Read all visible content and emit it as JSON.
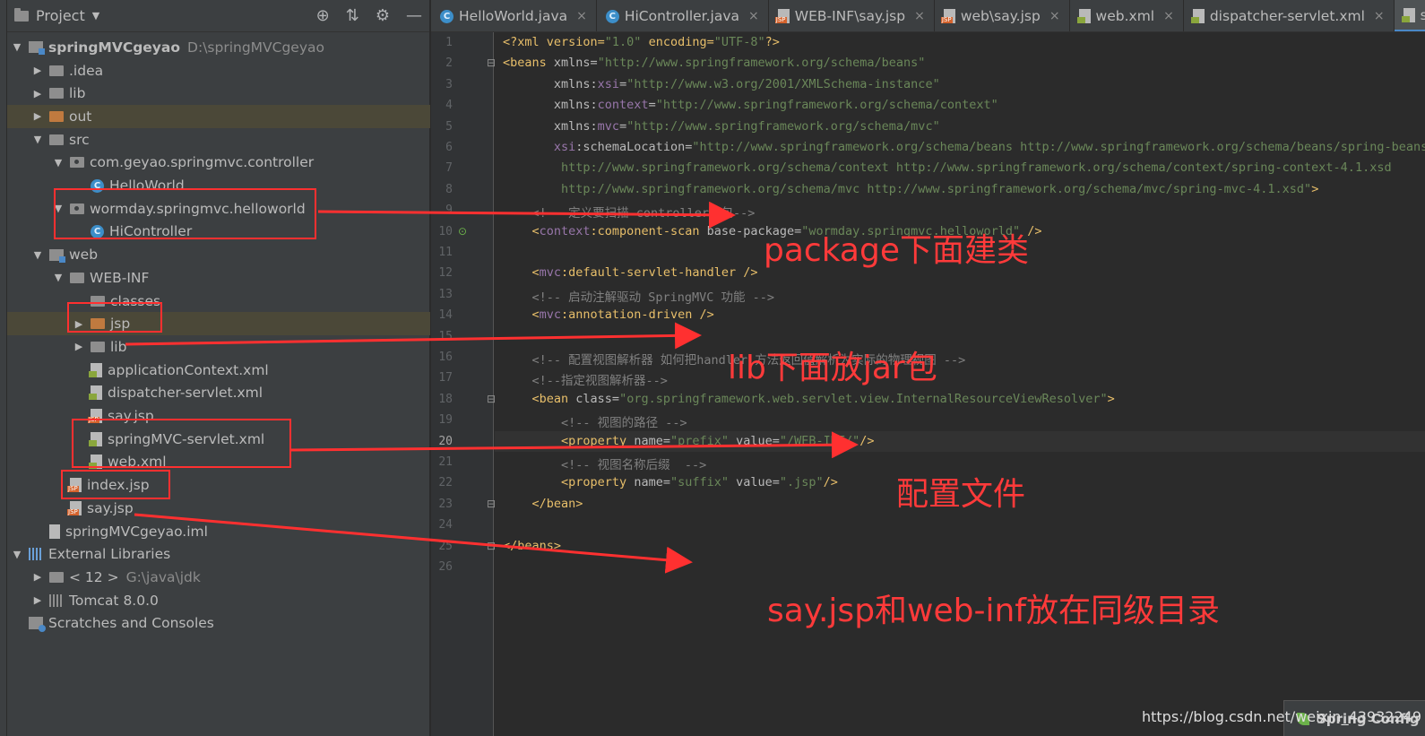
{
  "panel": {
    "title": "Project",
    "tools": {
      "locate": "⊕",
      "collapse": "⇅",
      "settings": "⚙",
      "hide": "—"
    }
  },
  "tree": [
    {
      "depth": 0,
      "arrow": "▼",
      "icon": "module",
      "label": "springMVCgeyao",
      "path": "D:\\springMVCgeyao",
      "bold": true
    },
    {
      "depth": 1,
      "arrow": "▶",
      "icon": "folder",
      "label": ".idea"
    },
    {
      "depth": 1,
      "arrow": "▶",
      "icon": "folder",
      "label": "lib"
    },
    {
      "depth": 1,
      "arrow": "▶",
      "icon": "folder-orange",
      "label": "out",
      "highlight": true
    },
    {
      "depth": 1,
      "arrow": "▼",
      "icon": "folder",
      "label": "src"
    },
    {
      "depth": 2,
      "arrow": "▼",
      "icon": "package",
      "label": "com.geyao.springmvc.controller"
    },
    {
      "depth": 3,
      "arrow": "",
      "icon": "class",
      "label": "HelloWorld"
    },
    {
      "depth": 2,
      "arrow": "▼",
      "icon": "package",
      "label": "wormday.springmvc.helloworld"
    },
    {
      "depth": 3,
      "arrow": "",
      "icon": "class",
      "label": "HiController"
    },
    {
      "depth": 1,
      "arrow": "▼",
      "icon": "module",
      "label": "web"
    },
    {
      "depth": 2,
      "arrow": "▼",
      "icon": "folder",
      "label": "WEB-INF"
    },
    {
      "depth": 3,
      "arrow": "",
      "icon": "folder",
      "label": "classes"
    },
    {
      "depth": 3,
      "arrow": "▶",
      "icon": "folder-orange",
      "label": "jsp",
      "highlight": true
    },
    {
      "depth": 3,
      "arrow": "▶",
      "icon": "folder",
      "label": "lib"
    },
    {
      "depth": 3,
      "arrow": "",
      "icon": "xml",
      "label": "applicationContext.xml"
    },
    {
      "depth": 3,
      "arrow": "",
      "icon": "xml",
      "label": "dispatcher-servlet.xml"
    },
    {
      "depth": 3,
      "arrow": "",
      "icon": "jsp",
      "label": "say.jsp"
    },
    {
      "depth": 3,
      "arrow": "",
      "icon": "xml",
      "label": "springMVC-servlet.xml"
    },
    {
      "depth": 3,
      "arrow": "",
      "icon": "xml",
      "label": "web.xml"
    },
    {
      "depth": 2,
      "arrow": "",
      "icon": "jsp",
      "label": "index.jsp"
    },
    {
      "depth": 2,
      "arrow": "",
      "icon": "jsp",
      "label": "say.jsp"
    },
    {
      "depth": 1,
      "arrow": "",
      "icon": "iml",
      "label": "springMVCgeyao.iml"
    },
    {
      "depth": 0,
      "arrow": "▼",
      "icon": "lib-blue",
      "label": "External Libraries"
    },
    {
      "depth": 1,
      "arrow": "▶",
      "icon": "folder",
      "label": "< 12 >",
      "path": "G:\\java\\jdk"
    },
    {
      "depth": 1,
      "arrow": "▶",
      "icon": "lib",
      "label": "Tomcat 8.0.0"
    },
    {
      "depth": 0,
      "arrow": "",
      "icon": "scratch",
      "label": "Scratches and Consoles"
    }
  ],
  "tabs": [
    {
      "label": "HelloWorld.java",
      "icon": "class"
    },
    {
      "label": "HiController.java",
      "icon": "class"
    },
    {
      "label": "WEB-INF\\say.jsp",
      "icon": "jsp"
    },
    {
      "label": "web\\say.jsp",
      "icon": "jsp"
    },
    {
      "label": "web.xml",
      "icon": "xml"
    },
    {
      "label": "dispatcher-servlet.xml",
      "icon": "xml"
    },
    {
      "label": "springMVC-servlet.xml",
      "icon": "xml",
      "active": true
    }
  ],
  "tab_close": "×",
  "current_line": 20,
  "code": [
    [
      [
        "t",
        "<?xml version="
      ],
      [
        "s",
        "\"1.0\""
      ],
      [
        "t",
        " encoding="
      ],
      [
        "s",
        "\"UTF-8\""
      ],
      [
        "t",
        "?>"
      ]
    ],
    [
      [
        "t",
        "<beans "
      ],
      [
        "a",
        "xmlns="
      ],
      [
        "s",
        "\"http://www.springframework.org/schema/beans\""
      ]
    ],
    [
      [
        "a",
        "       xmlns:"
      ],
      [
        "n",
        "xsi"
      ],
      [
        "a",
        "="
      ],
      [
        "s",
        "\"http://www.w3.org/2001/XMLSchema-instance\""
      ]
    ],
    [
      [
        "a",
        "       xmlns:"
      ],
      [
        "n",
        "context"
      ],
      [
        "a",
        "="
      ],
      [
        "s",
        "\"http://www.springframework.org/schema/context\""
      ]
    ],
    [
      [
        "a",
        "       xmlns:"
      ],
      [
        "n",
        "mvc"
      ],
      [
        "a",
        "="
      ],
      [
        "s",
        "\"http://www.springframework.org/schema/mvc\""
      ]
    ],
    [
      [
        "n",
        "       xsi"
      ],
      [
        "a",
        ":schemaLocation="
      ],
      [
        "s",
        "\"http://www.springframework.org/schema/beans http://www.springframework.org/schema/beans/spring-beans.xsd"
      ]
    ],
    [
      [
        "s",
        "        http://www.springframework.org/schema/context http://www.springframework.org/schema/context/spring-context-4.1.xsd"
      ]
    ],
    [
      [
        "s",
        "        http://www.springframework.org/schema/mvc http://www.springframework.org/schema/mvc/spring-mvc-4.1.xsd\""
      ],
      [
        "t",
        ">"
      ]
    ],
    [
      [
        "c",
        "    <!-- 定义要扫描 controller的包-->"
      ]
    ],
    [
      [
        "t",
        "    <"
      ],
      [
        "n",
        "context"
      ],
      [
        "t",
        ":component-scan "
      ],
      [
        "a",
        "base-package="
      ],
      [
        "s",
        "\"wormday.springmvc.helloworld\""
      ],
      [
        "t",
        " />"
      ]
    ],
    [],
    [
      [
        "t",
        "    <"
      ],
      [
        "n",
        "mvc"
      ],
      [
        "t",
        ":default-servlet-handler />"
      ]
    ],
    [
      [
        "c",
        "    <!-- 启动注解驱动 SpringMVC 功能 -->"
      ]
    ],
    [
      [
        "t",
        "    <"
      ],
      [
        "n",
        "mvc"
      ],
      [
        "t",
        ":annotation-driven />"
      ]
    ],
    [],
    [
      [
        "c",
        "    <!-- 配置视图解析器 如何把handler 方法返回值解析为实际的物理视图 -->"
      ]
    ],
    [
      [
        "c",
        "    <!--指定视图解析器-->"
      ]
    ],
    [
      [
        "t",
        "    <bean "
      ],
      [
        "a",
        "class="
      ],
      [
        "s",
        "\"org.springframework.web.servlet.view.InternalResourceViewResolver\""
      ],
      [
        "t",
        ">"
      ]
    ],
    [
      [
        "c",
        "        <!-- 视图的路径 -->"
      ]
    ],
    [
      [
        "t",
        "        <property "
      ],
      [
        "a",
        "name="
      ],
      [
        "s",
        "\"prefix\""
      ],
      [
        "a",
        " value="
      ],
      [
        "s",
        "\"/WEB-INF/\""
      ],
      [
        "t",
        "/>"
      ]
    ],
    [
      [
        "c",
        "        <!-- 视图名称后缀  -->"
      ]
    ],
    [
      [
        "t",
        "        <property "
      ],
      [
        "a",
        "name="
      ],
      [
        "s",
        "\"suffix\""
      ],
      [
        "a",
        " value="
      ],
      [
        "s",
        "\".jsp\""
      ],
      [
        "t",
        "/>"
      ]
    ],
    [
      [
        "t",
        "    </bean>"
      ]
    ],
    [],
    [
      [
        "t",
        "</beans>"
      ]
    ],
    []
  ],
  "annotations": [
    {
      "text": "package下面建类"
    },
    {
      "text": "lib下面放jar包"
    },
    {
      "text": "配置文件"
    },
    {
      "text": "say.jsp和web-inf放在同级目录"
    }
  ],
  "watermark": "https://blog.csdn.net/weixin_43932249",
  "badge": "Spring Config",
  "colors": {
    "annotation_red": "#ff3030",
    "bg_editor": "#2b2b2b",
    "bg_panel": "#3c3f41",
    "active_tab": "#4a88c7"
  }
}
